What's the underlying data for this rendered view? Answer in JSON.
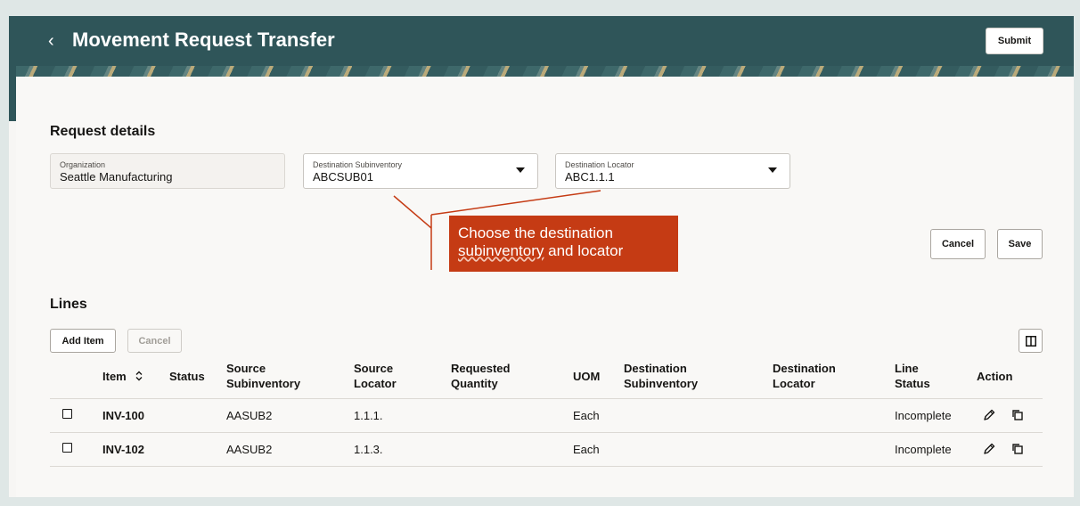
{
  "header": {
    "title": "Movement Request Transfer",
    "submit_label": "Submit"
  },
  "request_details": {
    "section_title": "Request details",
    "organization": {
      "label": "Organization",
      "value": "Seattle Manufacturing"
    },
    "destination_subinventory": {
      "label": "Destination Subinventory",
      "value": "ABCSUB01"
    },
    "destination_locator": {
      "label": "Destination Locator",
      "value": "ABC1.1.1"
    }
  },
  "callout": {
    "line1": "Choose the destination",
    "line2_underlined": "subinventory",
    "line2_rest": " and locator"
  },
  "actions": {
    "cancel_label": "Cancel",
    "save_label": "Save"
  },
  "lines": {
    "section_title": "Lines",
    "add_item_label": "Add Item",
    "cancel_label": "Cancel",
    "columns": {
      "item": "Item",
      "status": "Status",
      "source_subinventory_1": "Source",
      "source_subinventory_2": "Subinventory",
      "source_locator_1": "Source",
      "source_locator_2": "Locator",
      "requested_quantity_1": "Requested",
      "requested_quantity_2": "Quantity",
      "uom": "UOM",
      "destination_subinventory_1": "Destination",
      "destination_subinventory_2": "Subinventory",
      "destination_locator_1": "Destination",
      "destination_locator_2": "Locator",
      "line_status_1": "Line",
      "line_status_2": "Status",
      "action": "Action"
    },
    "rows": [
      {
        "item": "INV-100",
        "status": "",
        "source_subinventory": "AASUB2",
        "source_locator": "1.1.1.",
        "requested_quantity": "",
        "uom": "Each",
        "destination_subinventory": "",
        "destination_locator": "",
        "line_status": "Incomplete"
      },
      {
        "item": "INV-102",
        "status": "",
        "source_subinventory": "AASUB2",
        "source_locator": "1.1.3.",
        "requested_quantity": "",
        "uom": "Each",
        "destination_subinventory": "",
        "destination_locator": "",
        "line_status": "Incomplete"
      }
    ]
  },
  "icons": {
    "back": "chevron-left-icon",
    "sort": "sort-icon",
    "columns": "columns-icon",
    "edit": "pencil-icon",
    "duplicate": "duplicate-icon"
  },
  "colors": {
    "header_bg": "#2f5559",
    "callout_bg": "#c53b14"
  }
}
